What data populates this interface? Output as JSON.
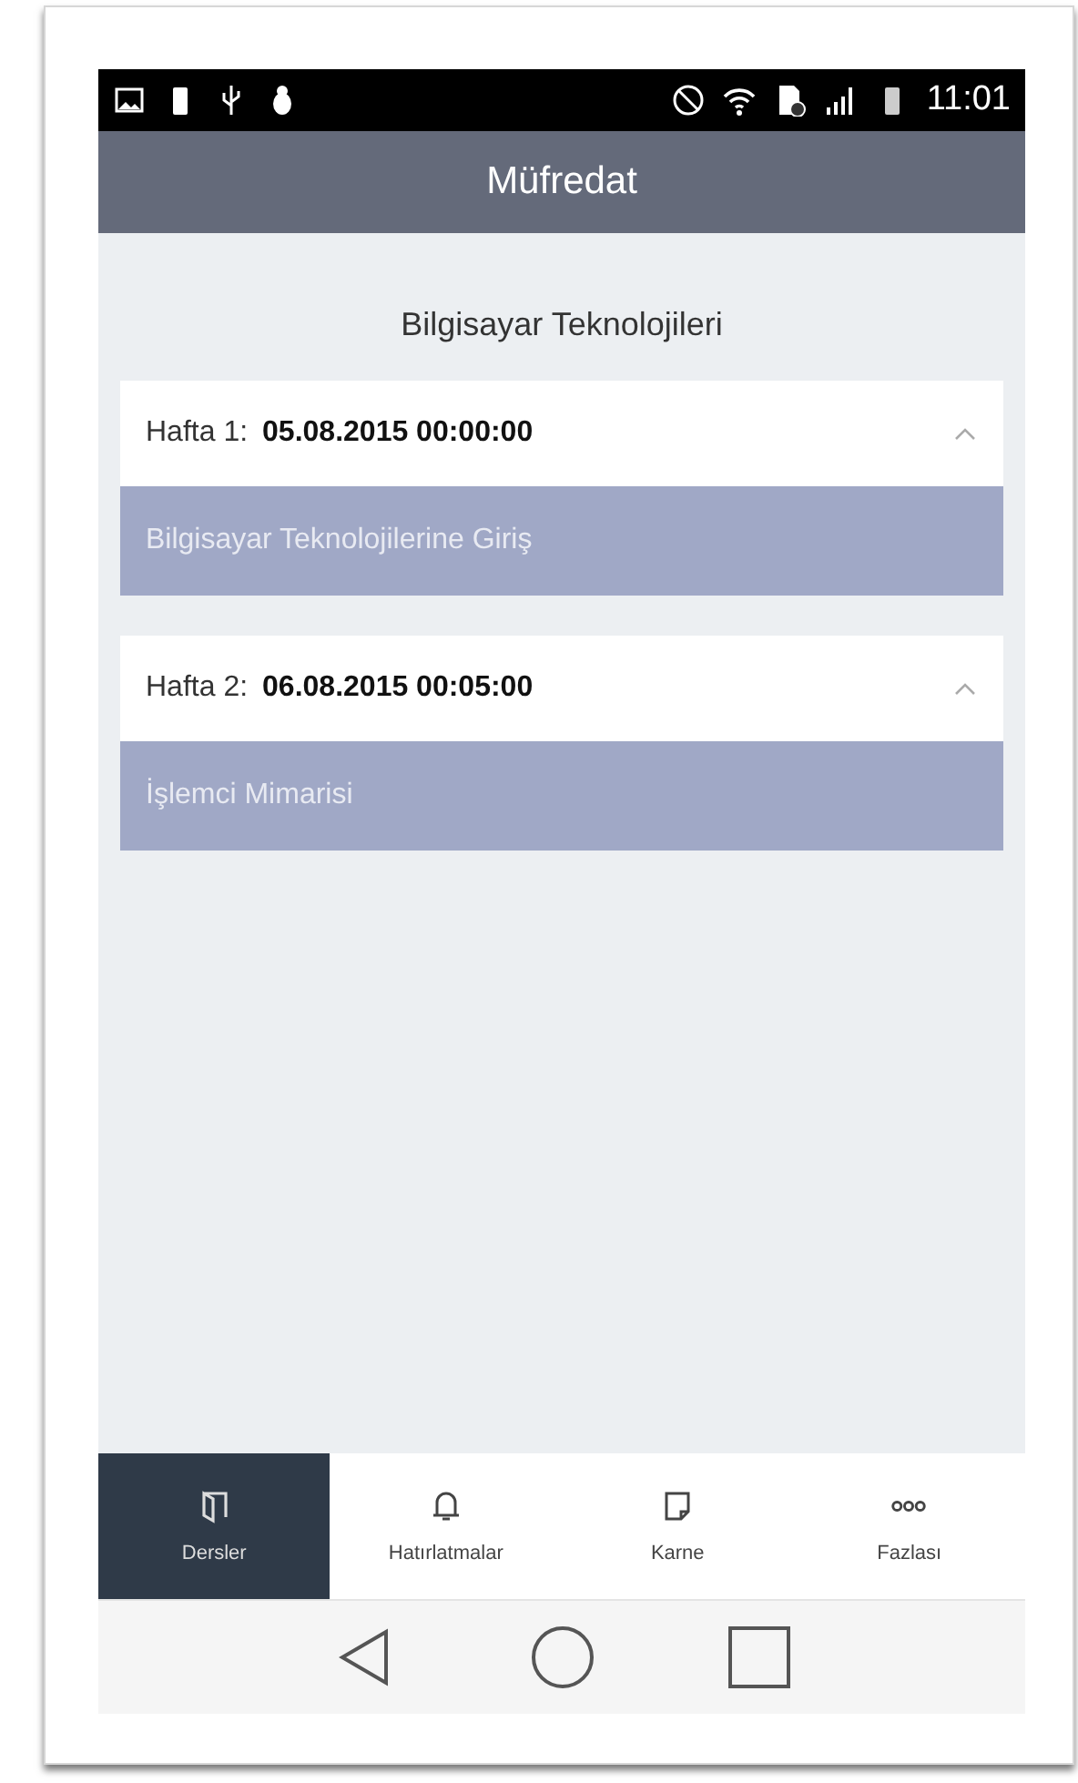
{
  "status_bar": {
    "time": "11:01"
  },
  "header": {
    "title": "Müfredat"
  },
  "course_title": "Bilgisayar Teknolojileri",
  "weeks": [
    {
      "label": "Hafta 1:",
      "date": "05.08.2015 00:00:00",
      "expanded": true,
      "topic": "Bilgisayar Teknolojilerine Giriş"
    },
    {
      "label": "Hafta 2:",
      "date": "06.08.2015 00:05:00",
      "expanded": true,
      "topic": "İşlemci Mimarisi"
    }
  ],
  "tabs": [
    {
      "label": "Dersler",
      "kind": "book",
      "selected": true
    },
    {
      "label": "Hatırlatmalar",
      "kind": "bell",
      "selected": false
    },
    {
      "label": "Karne",
      "kind": "note",
      "selected": false
    },
    {
      "label": "Fazlası",
      "kind": "more",
      "selected": false
    }
  ]
}
